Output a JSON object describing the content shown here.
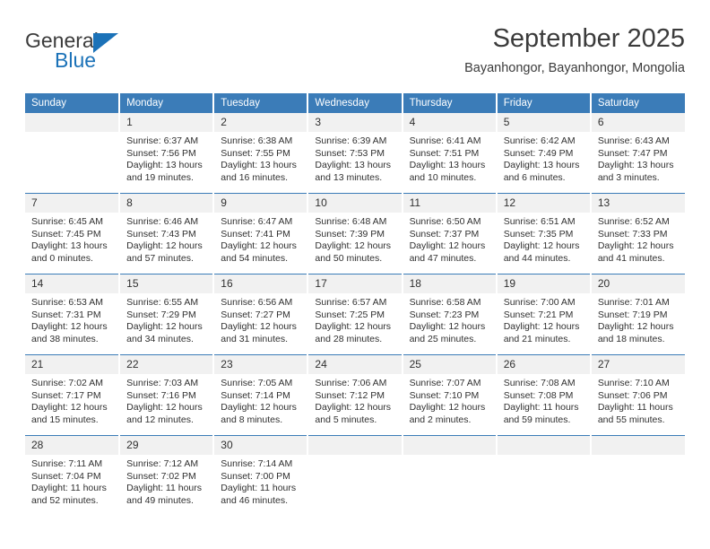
{
  "brand": {
    "name_top": "General",
    "name_bottom": "Blue",
    "accent_color": "#1b72b8"
  },
  "header": {
    "title": "September 2025",
    "location": "Bayanhongor, Bayanhongor, Mongolia"
  },
  "calendar": {
    "header_bg": "#3b7cb8",
    "daynum_bg": "#f1f1f1",
    "weekdays": [
      "Sunday",
      "Monday",
      "Tuesday",
      "Wednesday",
      "Thursday",
      "Friday",
      "Saturday"
    ],
    "weeks": [
      [
        {
          "day": "",
          "empty": true,
          "sunrise": "",
          "sunset": "",
          "daylight_line1": "",
          "daylight_line2": ""
        },
        {
          "day": "1",
          "sunrise": "Sunrise: 6:37 AM",
          "sunset": "Sunset: 7:56 PM",
          "daylight_line1": "Daylight: 13 hours",
          "daylight_line2": "and 19 minutes."
        },
        {
          "day": "2",
          "sunrise": "Sunrise: 6:38 AM",
          "sunset": "Sunset: 7:55 PM",
          "daylight_line1": "Daylight: 13 hours",
          "daylight_line2": "and 16 minutes."
        },
        {
          "day": "3",
          "sunrise": "Sunrise: 6:39 AM",
          "sunset": "Sunset: 7:53 PM",
          "daylight_line1": "Daylight: 13 hours",
          "daylight_line2": "and 13 minutes."
        },
        {
          "day": "4",
          "sunrise": "Sunrise: 6:41 AM",
          "sunset": "Sunset: 7:51 PM",
          "daylight_line1": "Daylight: 13 hours",
          "daylight_line2": "and 10 minutes."
        },
        {
          "day": "5",
          "sunrise": "Sunrise: 6:42 AM",
          "sunset": "Sunset: 7:49 PM",
          "daylight_line1": "Daylight: 13 hours",
          "daylight_line2": "and 6 minutes."
        },
        {
          "day": "6",
          "sunrise": "Sunrise: 6:43 AM",
          "sunset": "Sunset: 7:47 PM",
          "daylight_line1": "Daylight: 13 hours",
          "daylight_line2": "and 3 minutes."
        }
      ],
      [
        {
          "day": "7",
          "sunrise": "Sunrise: 6:45 AM",
          "sunset": "Sunset: 7:45 PM",
          "daylight_line1": "Daylight: 13 hours",
          "daylight_line2": "and 0 minutes."
        },
        {
          "day": "8",
          "sunrise": "Sunrise: 6:46 AM",
          "sunset": "Sunset: 7:43 PM",
          "daylight_line1": "Daylight: 12 hours",
          "daylight_line2": "and 57 minutes."
        },
        {
          "day": "9",
          "sunrise": "Sunrise: 6:47 AM",
          "sunset": "Sunset: 7:41 PM",
          "daylight_line1": "Daylight: 12 hours",
          "daylight_line2": "and 54 minutes."
        },
        {
          "day": "10",
          "sunrise": "Sunrise: 6:48 AM",
          "sunset": "Sunset: 7:39 PM",
          "daylight_line1": "Daylight: 12 hours",
          "daylight_line2": "and 50 minutes."
        },
        {
          "day": "11",
          "sunrise": "Sunrise: 6:50 AM",
          "sunset": "Sunset: 7:37 PM",
          "daylight_line1": "Daylight: 12 hours",
          "daylight_line2": "and 47 minutes."
        },
        {
          "day": "12",
          "sunrise": "Sunrise: 6:51 AM",
          "sunset": "Sunset: 7:35 PM",
          "daylight_line1": "Daylight: 12 hours",
          "daylight_line2": "and 44 minutes."
        },
        {
          "day": "13",
          "sunrise": "Sunrise: 6:52 AM",
          "sunset": "Sunset: 7:33 PM",
          "daylight_line1": "Daylight: 12 hours",
          "daylight_line2": "and 41 minutes."
        }
      ],
      [
        {
          "day": "14",
          "sunrise": "Sunrise: 6:53 AM",
          "sunset": "Sunset: 7:31 PM",
          "daylight_line1": "Daylight: 12 hours",
          "daylight_line2": "and 38 minutes."
        },
        {
          "day": "15",
          "sunrise": "Sunrise: 6:55 AM",
          "sunset": "Sunset: 7:29 PM",
          "daylight_line1": "Daylight: 12 hours",
          "daylight_line2": "and 34 minutes."
        },
        {
          "day": "16",
          "sunrise": "Sunrise: 6:56 AM",
          "sunset": "Sunset: 7:27 PM",
          "daylight_line1": "Daylight: 12 hours",
          "daylight_line2": "and 31 minutes."
        },
        {
          "day": "17",
          "sunrise": "Sunrise: 6:57 AM",
          "sunset": "Sunset: 7:25 PM",
          "daylight_line1": "Daylight: 12 hours",
          "daylight_line2": "and 28 minutes."
        },
        {
          "day": "18",
          "sunrise": "Sunrise: 6:58 AM",
          "sunset": "Sunset: 7:23 PM",
          "daylight_line1": "Daylight: 12 hours",
          "daylight_line2": "and 25 minutes."
        },
        {
          "day": "19",
          "sunrise": "Sunrise: 7:00 AM",
          "sunset": "Sunset: 7:21 PM",
          "daylight_line1": "Daylight: 12 hours",
          "daylight_line2": "and 21 minutes."
        },
        {
          "day": "20",
          "sunrise": "Sunrise: 7:01 AM",
          "sunset": "Sunset: 7:19 PM",
          "daylight_line1": "Daylight: 12 hours",
          "daylight_line2": "and 18 minutes."
        }
      ],
      [
        {
          "day": "21",
          "sunrise": "Sunrise: 7:02 AM",
          "sunset": "Sunset: 7:17 PM",
          "daylight_line1": "Daylight: 12 hours",
          "daylight_line2": "and 15 minutes."
        },
        {
          "day": "22",
          "sunrise": "Sunrise: 7:03 AM",
          "sunset": "Sunset: 7:16 PM",
          "daylight_line1": "Daylight: 12 hours",
          "daylight_line2": "and 12 minutes."
        },
        {
          "day": "23",
          "sunrise": "Sunrise: 7:05 AM",
          "sunset": "Sunset: 7:14 PM",
          "daylight_line1": "Daylight: 12 hours",
          "daylight_line2": "and 8 minutes."
        },
        {
          "day": "24",
          "sunrise": "Sunrise: 7:06 AM",
          "sunset": "Sunset: 7:12 PM",
          "daylight_line1": "Daylight: 12 hours",
          "daylight_line2": "and 5 minutes."
        },
        {
          "day": "25",
          "sunrise": "Sunrise: 7:07 AM",
          "sunset": "Sunset: 7:10 PM",
          "daylight_line1": "Daylight: 12 hours",
          "daylight_line2": "and 2 minutes."
        },
        {
          "day": "26",
          "sunrise": "Sunrise: 7:08 AM",
          "sunset": "Sunset: 7:08 PM",
          "daylight_line1": "Daylight: 11 hours",
          "daylight_line2": "and 59 minutes."
        },
        {
          "day": "27",
          "sunrise": "Sunrise: 7:10 AM",
          "sunset": "Sunset: 7:06 PM",
          "daylight_line1": "Daylight: 11 hours",
          "daylight_line2": "and 55 minutes."
        }
      ],
      [
        {
          "day": "28",
          "sunrise": "Sunrise: 7:11 AM",
          "sunset": "Sunset: 7:04 PM",
          "daylight_line1": "Daylight: 11 hours",
          "daylight_line2": "and 52 minutes."
        },
        {
          "day": "29",
          "sunrise": "Sunrise: 7:12 AM",
          "sunset": "Sunset: 7:02 PM",
          "daylight_line1": "Daylight: 11 hours",
          "daylight_line2": "and 49 minutes."
        },
        {
          "day": "30",
          "sunrise": "Sunrise: 7:14 AM",
          "sunset": "Sunset: 7:00 PM",
          "daylight_line1": "Daylight: 11 hours",
          "daylight_line2": "and 46 minutes."
        },
        {
          "day": "",
          "empty": true,
          "sunrise": "",
          "sunset": "",
          "daylight_line1": "",
          "daylight_line2": ""
        },
        {
          "day": "",
          "empty": true,
          "sunrise": "",
          "sunset": "",
          "daylight_line1": "",
          "daylight_line2": ""
        },
        {
          "day": "",
          "empty": true,
          "sunrise": "",
          "sunset": "",
          "daylight_line1": "",
          "daylight_line2": ""
        },
        {
          "day": "",
          "empty": true,
          "sunrise": "",
          "sunset": "",
          "daylight_line1": "",
          "daylight_line2": ""
        }
      ]
    ]
  }
}
